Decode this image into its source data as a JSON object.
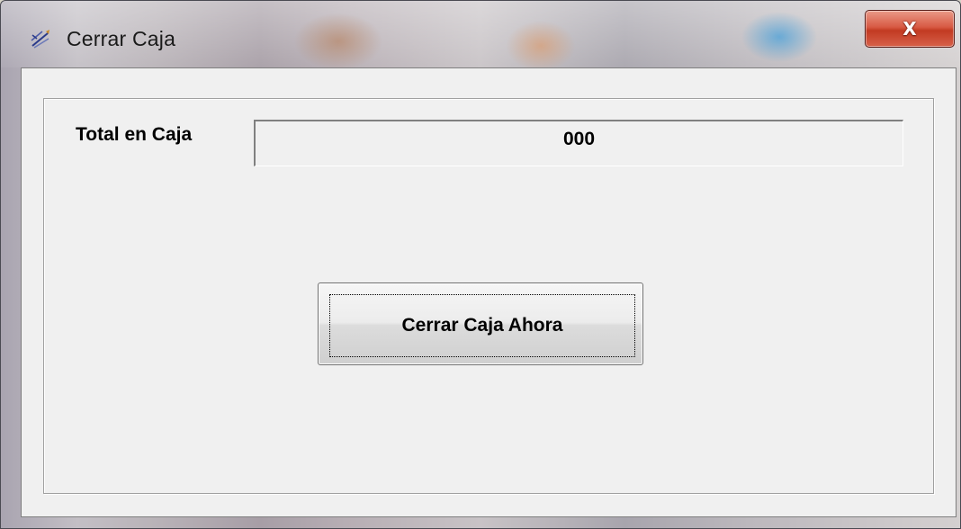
{
  "window": {
    "title": "Cerrar Caja",
    "close_glyph": "X",
    "title_icon": "notepad-pen-icon",
    "close_icon": "close-icon"
  },
  "form": {
    "total_label": "Total en Caja",
    "total_value": "000",
    "close_button_label": "Cerrar Caja Ahora"
  },
  "colors": {
    "close_button": "#c8402a",
    "client_background": "#f0f0f0"
  }
}
